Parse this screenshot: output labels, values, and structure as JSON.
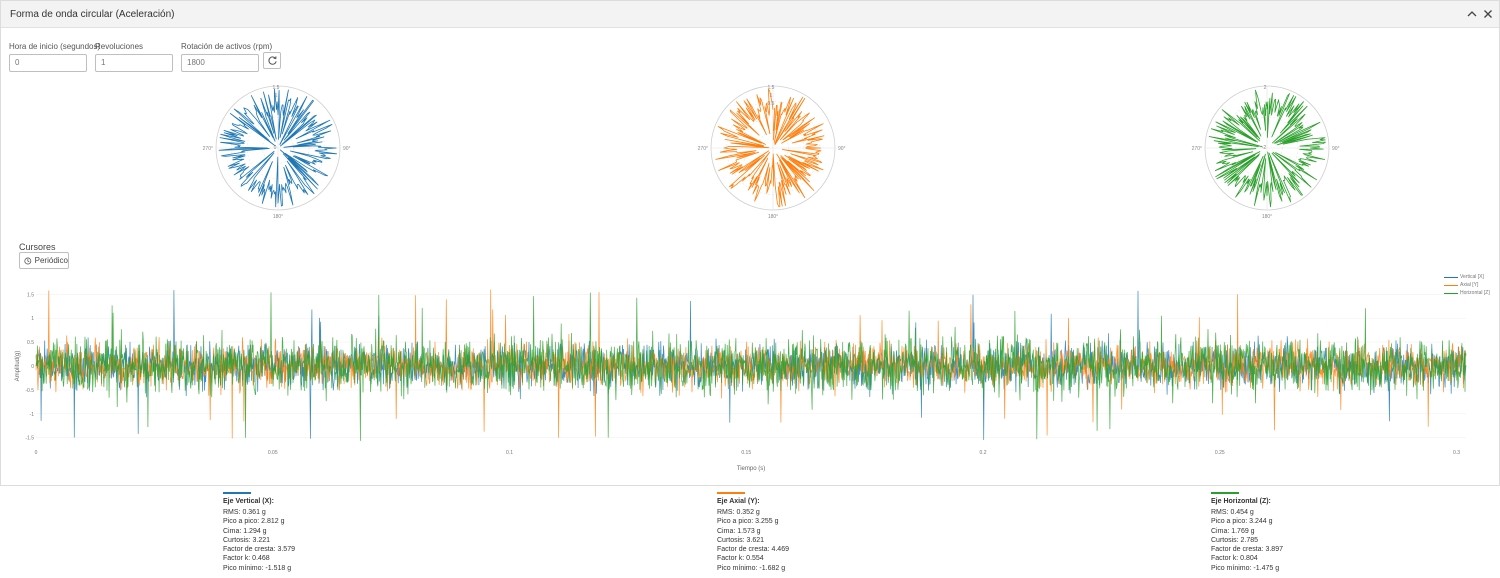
{
  "window": {
    "title": "Forma de onda circular (Aceleración)",
    "collapse_icon": "chevron-up-icon",
    "close_icon": "close-icon"
  },
  "controls": {
    "start_label": "Hora de inicio (segundos)",
    "start_value": "0",
    "revolutions_label": "Revoluciones",
    "revolutions_value": "1",
    "rotation_label": "Rotación de activos (rpm)",
    "rotation_value": "1800",
    "refresh_icon": "refresh-icon"
  },
  "polar": [
    {
      "axis": "Vertical [X]",
      "color": "#1f77b4",
      "r_max": 1.5,
      "r_labels": [
        "1.5",
        "1"
      ],
      "center_label": "0",
      "angles": [
        "90°",
        "180°",
        "270°"
      ]
    },
    {
      "axis": "Axial [Y]",
      "color": "#ff7f0e",
      "r_max": 1.5,
      "r_labels": [
        "1.5",
        "1",
        "0.5"
      ],
      "center_label": "",
      "angles": [
        "90°",
        "180°",
        "270°"
      ]
    },
    {
      "axis": "Horizontal [Z]",
      "color": "#2ca02c",
      "r_max": 2,
      "r_labels": [
        "2"
      ],
      "center_label": "-2",
      "angles": [
        "90°",
        "180°",
        "270°"
      ]
    }
  ],
  "cursors": {
    "heading": "Cursores",
    "periodic_label": "Periódico",
    "periodic_icon": "clock-icon"
  },
  "chart_data": {
    "type": "line",
    "title": "",
    "xlabel": "Tiempo (s)",
    "ylabel": "Amplitud(g)",
    "xlim": [
      0,
      0.302
    ],
    "ylim": [
      -1.8,
      1.8
    ],
    "x_ticks": [
      "0",
      "0.05",
      "0.1",
      "0.15",
      "0.2",
      "0.25",
      "0.3"
    ],
    "y_ticks": [
      "1.5",
      "1",
      "0.5",
      "0",
      "-0.5",
      "-1",
      "-1.5"
    ],
    "legend_position": "top-right",
    "series": [
      {
        "name": "Vertical [X]",
        "color": "#1f77b4",
        "rms": 0.361,
        "min": -1.518
      },
      {
        "name": "Axial [Y]",
        "color": "#ff7f0e",
        "rms": 0.352,
        "min": -1.682
      },
      {
        "name": "Horizontal [Z]",
        "color": "#2ca02c",
        "rms": 0.454,
        "min": -1.475
      }
    ]
  },
  "stats": [
    {
      "name": "Eje Vertical (X):",
      "color": "#1f77b4",
      "lines": [
        "RMS:  0.361 g",
        "Pico a pico:  2.812 g",
        "Cima:  1.294 g",
        "Curtosis:  3.221",
        "Factor de cresta:  3.579",
        "Factor k:  0.468",
        "Pico mínimo:  -1.518 g"
      ]
    },
    {
      "name": "Eje Axial (Y):",
      "color": "#ff7f0e",
      "lines": [
        "RMS:  0.352 g",
        "Pico a pico:  3.255 g",
        "Cima:  1.573 g",
        "Curtosis:  3.621",
        "Factor de cresta:  4.469",
        "Factor k:  0.554",
        "Pico mínimo:  -1.682 g"
      ]
    },
    {
      "name": "Eje Horizontal (Z):",
      "color": "#2ca02c",
      "lines": [
        "RMS:  0.454 g",
        "Pico a pico:  3.244 g",
        "Cima:  1.769 g",
        "Curtosis:  2.785",
        "Factor de cresta:  3.897",
        "Factor k:  0.804",
        "Pico mínimo:  -1.475 g"
      ]
    }
  ]
}
